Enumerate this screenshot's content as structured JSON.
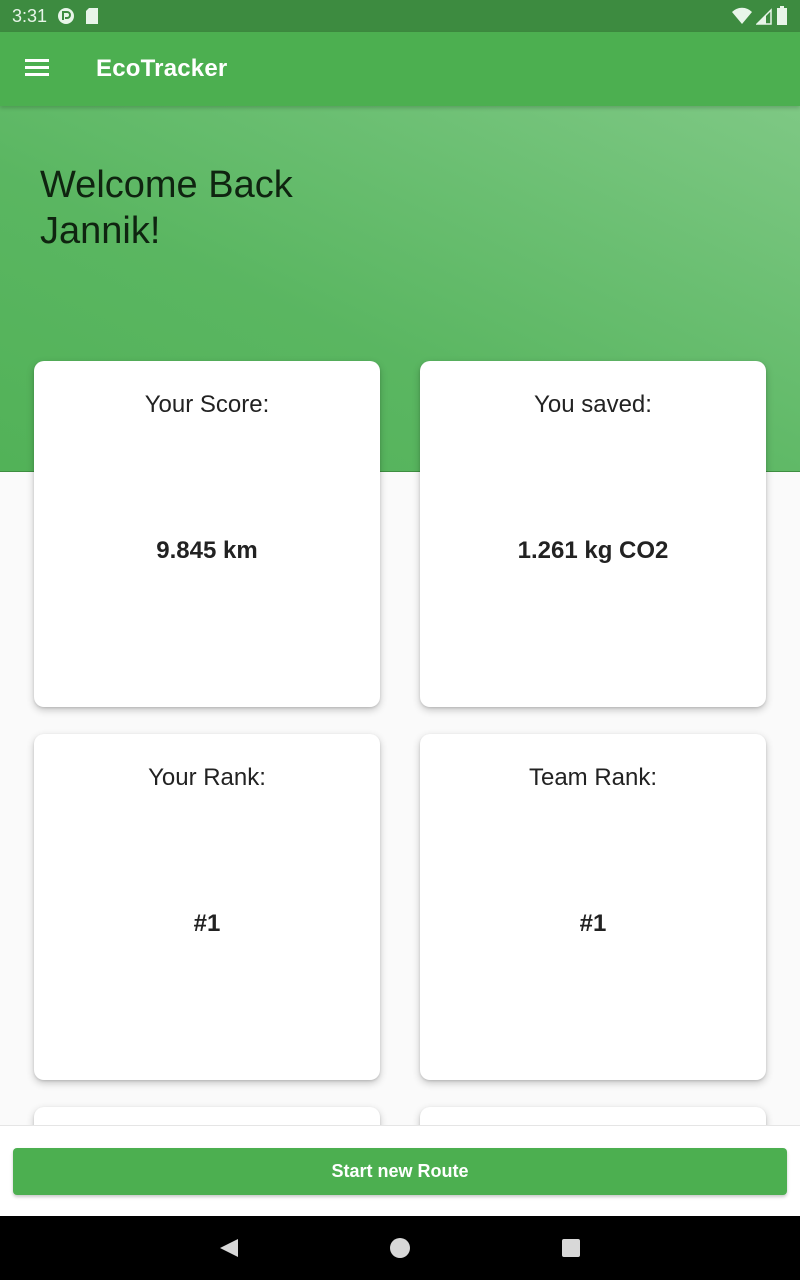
{
  "status_bar": {
    "time": "3:31",
    "icons": [
      "app-notification-icon",
      "sd-card-icon",
      "wifi-icon",
      "cell-signal-icon",
      "battery-icon"
    ]
  },
  "app_bar": {
    "title": "EcoTracker",
    "menu_icon": "hamburger-menu-icon"
  },
  "hero": {
    "welcome_line1": "Welcome Back",
    "welcome_line2": "Jannik!"
  },
  "cards": [
    {
      "title": "Your Score:",
      "value": "9.845 km"
    },
    {
      "title": "You saved:",
      "value": "1.261 kg CO2"
    },
    {
      "title": "Your Rank:",
      "value": "#1"
    },
    {
      "title": "Team Rank:",
      "value": "#1"
    }
  ],
  "actions": {
    "start_route_label": "Start new Route"
  },
  "nav_bar": {
    "icons": [
      "back-icon",
      "home-icon",
      "recents-icon"
    ]
  },
  "colors": {
    "primary": "#4caf50",
    "status_bar": "#3d8b40",
    "hero_light": "#7ec884",
    "background": "#fafafa",
    "card": "#ffffff"
  }
}
